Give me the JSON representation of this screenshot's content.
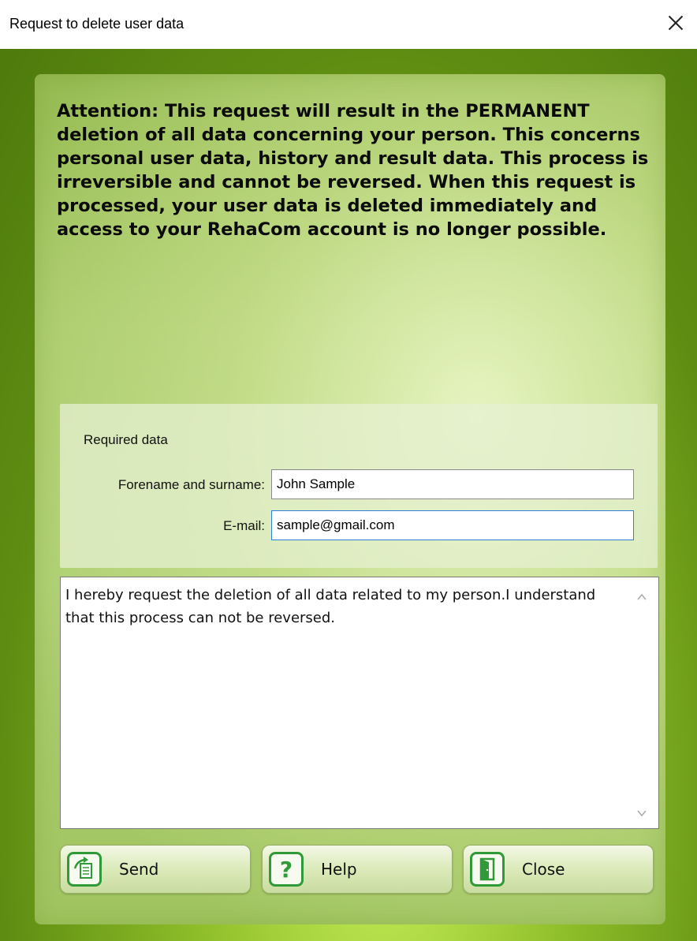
{
  "window": {
    "title": "Request to delete user data"
  },
  "warning_text": "Attention: This request will result in the PERMANENT deletion of all data concerning your person. This concerns personal user data, history and result data. This process is irreversible and cannot be reversed. When this request is processed, your user data is deleted immediately and access to your RehaCom account is no longer possible.",
  "required": {
    "heading": "Required data",
    "name_label": "Forename and surname:",
    "name_value": "John Sample",
    "email_label": "E-mail:",
    "email_value": "sample@gmail.com"
  },
  "message": "I hereby request the deletion of all data related to my person.I understand that this process can not be reversed.",
  "buttons": {
    "send": "Send",
    "help": "Help",
    "close": "Close"
  },
  "colors": {
    "accent_green": "#2f9a37",
    "frame_green": "#6e9d18"
  }
}
